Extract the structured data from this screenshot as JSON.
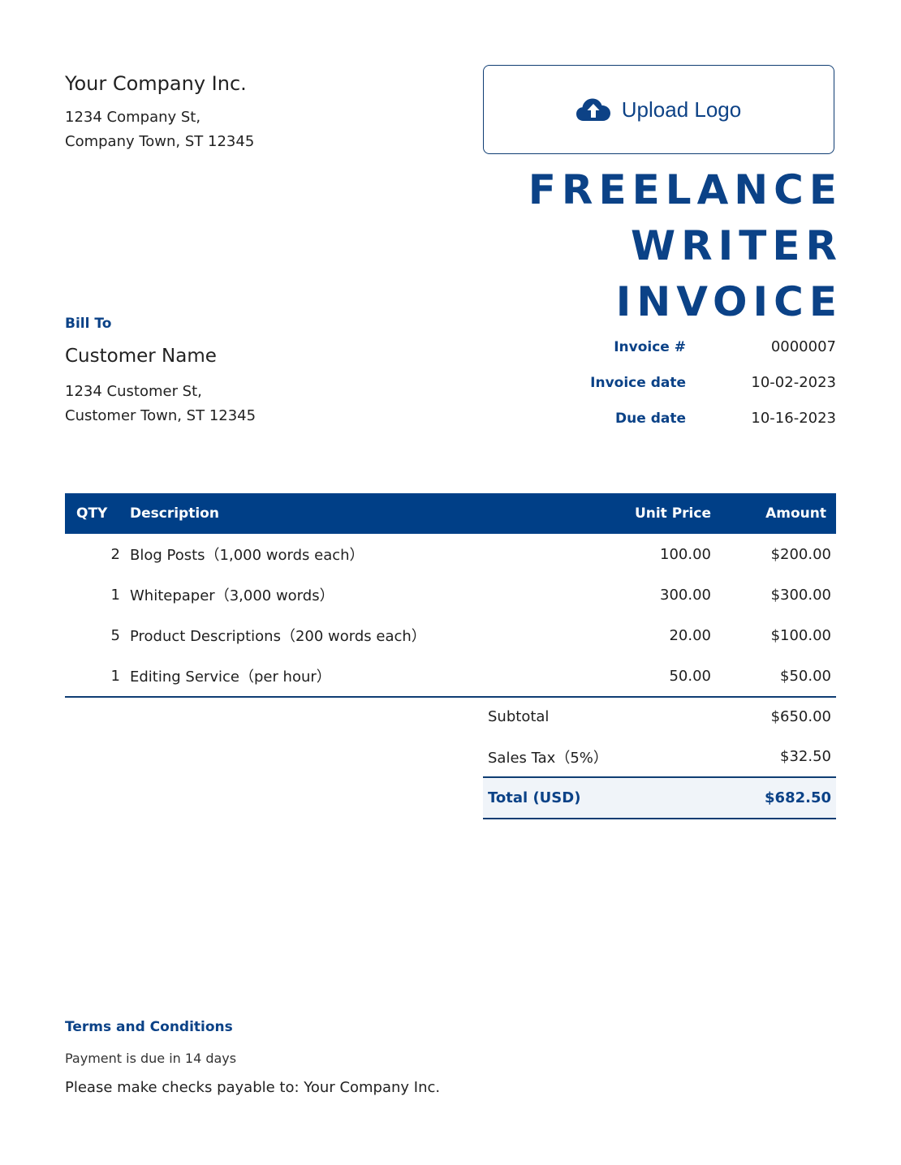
{
  "company": {
    "name": "Your Company Inc.",
    "address_line1": "1234 Company St,",
    "address_line2": "Company Town, ST 12345"
  },
  "upload_logo": {
    "label": "Upload Logo",
    "icon": "cloud-upload-icon"
  },
  "title": {
    "line1": "FREELANCE",
    "line2": "WRITER",
    "line3": "INVOICE"
  },
  "bill_to": {
    "label": "Bill To",
    "customer_name": "Customer Name",
    "address_line1": "1234 Customer St,",
    "address_line2": "Customer Town, ST 12345"
  },
  "invoice_meta": [
    {
      "label": "Invoice #",
      "value": "0000007"
    },
    {
      "label": "Invoice date",
      "value": "10-02-2023"
    },
    {
      "label": "Due date",
      "value": "10-16-2023"
    }
  ],
  "table": {
    "headers": {
      "qty": "QTY",
      "description": "Description",
      "unit_price": "Unit Price",
      "amount": "Amount"
    },
    "rows": [
      {
        "qty": "2",
        "description": "Blog Posts（1,000 words each）",
        "unit_price": "100.00",
        "amount": "$200.00"
      },
      {
        "qty": "1",
        "description": "Whitepaper（3,000 words）",
        "unit_price": "300.00",
        "amount": "$300.00"
      },
      {
        "qty": "5",
        "description": "Product Descriptions（200 words each）",
        "unit_price": "20.00",
        "amount": "$100.00"
      },
      {
        "qty": "1",
        "description": "Editing Service（per hour）",
        "unit_price": "50.00",
        "amount": "$50.00"
      }
    ]
  },
  "totals": {
    "subtotal_label": "Subtotal",
    "subtotal_value": "$650.00",
    "tax_label": "Sales Tax（5%）",
    "tax_value": "$32.50",
    "total_label": "Total (USD)",
    "total_value": "$682.50"
  },
  "terms": {
    "title": "Terms and Conditions",
    "line1": "Payment is due in 14 days",
    "line2": "Please make checks payable to: Your Company Inc."
  },
  "colors": {
    "brand": "#0b4287",
    "header_bg": "#003f87",
    "total_bg": "#f0f4f9"
  }
}
